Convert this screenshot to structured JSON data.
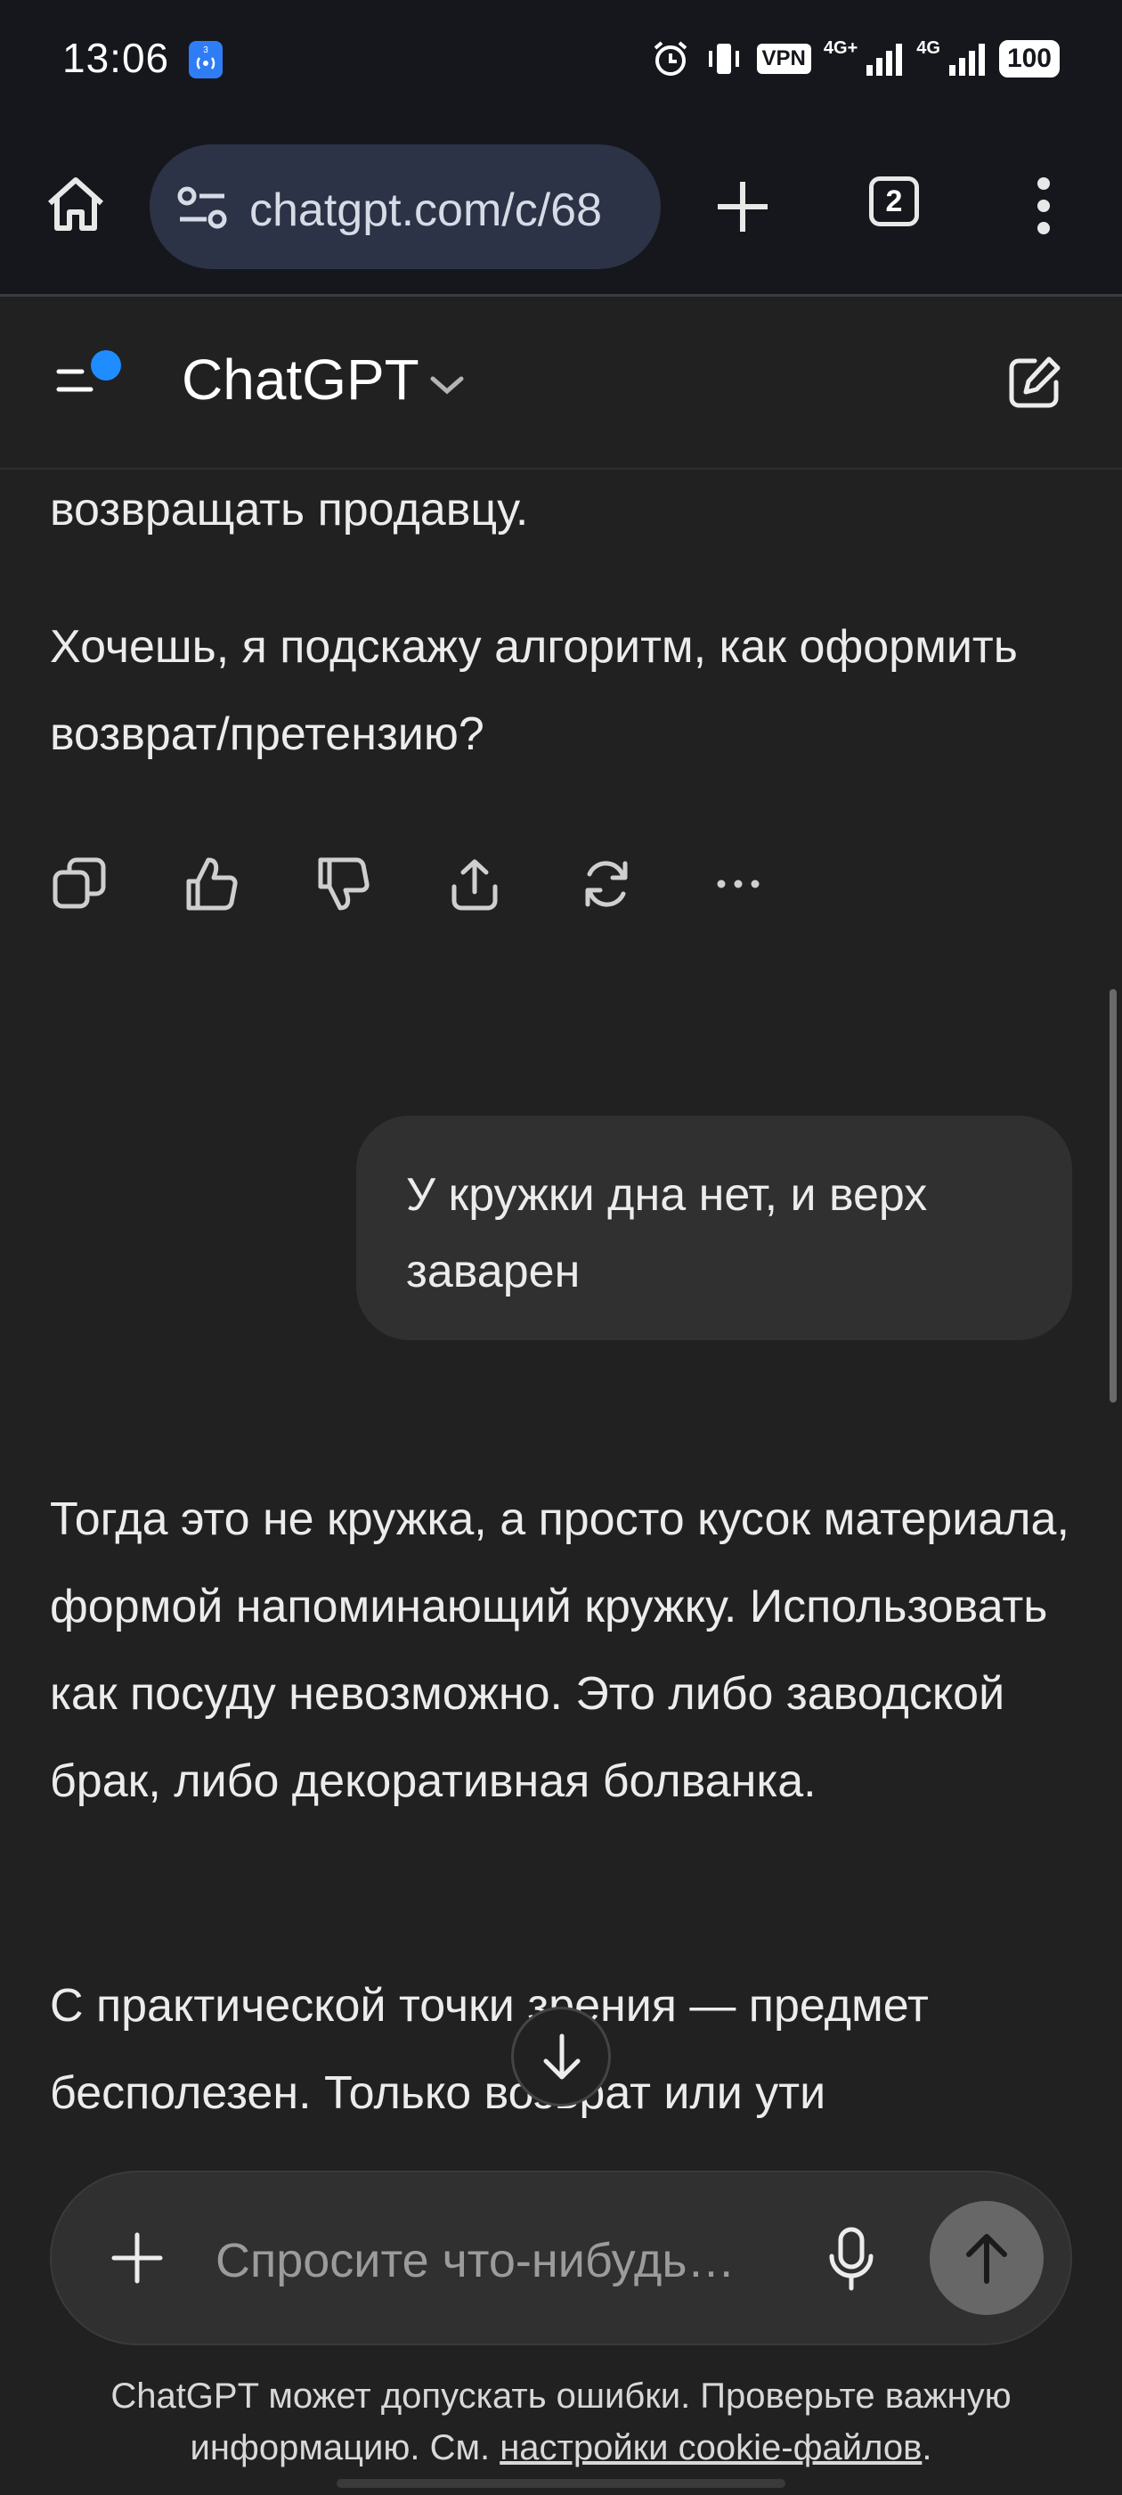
{
  "status_bar": {
    "time": "13:06",
    "vpn": "VPN",
    "network_1": "4G+",
    "network_2": "4G",
    "battery": "100"
  },
  "browser": {
    "url": "chatgpt.com/c/68",
    "tab_count": "2"
  },
  "header": {
    "title": "ChatGPT"
  },
  "messages": {
    "assistant_1_tail": "возвращать продавцу.",
    "assistant_1_question": "Хочешь, я подскажу алгоритм, как оформить возврат/претензию?",
    "user_1": "У кружки дна нет, и верх заварен",
    "assistant_2_p1": "Тогда это не кружка, а просто кусок материала, формой напоминающий кружку. Использовать как посуду невозможно. Это либо заводской брак, либо декоративная болванка.",
    "assistant_2_p2": "С практической точки зрения — предмет бесполезен. Только возврат или ути"
  },
  "composer": {
    "placeholder": "Спросите что-нибудь…"
  },
  "footer": {
    "disclaimer_text": "ChatGPT может допускать ошибки. Проверьте важную информацию. См. ",
    "cookie_link": "настройки cookie-файлов",
    "period": "."
  },
  "colors": {
    "background": "#212121",
    "bubble": "#303030",
    "accent_dot": "#1f8cff"
  }
}
